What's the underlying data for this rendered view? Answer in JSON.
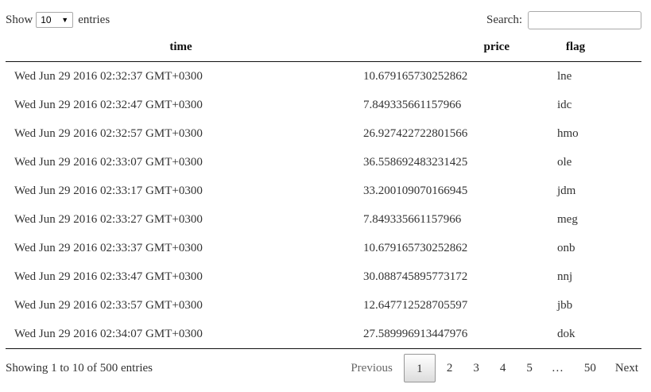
{
  "length_menu": {
    "prefix": "Show",
    "selected": "10",
    "suffix": "entries"
  },
  "search": {
    "label": "Search:",
    "value": ""
  },
  "columns": [
    "time",
    "price",
    "flag"
  ],
  "rows": [
    [
      "Wed Jun 29 2016 02:32:37 GMT+0300",
      "10.679165730252862",
      "lne"
    ],
    [
      "Wed Jun 29 2016 02:32:47 GMT+0300",
      "7.849335661157966",
      "idc"
    ],
    [
      "Wed Jun 29 2016 02:32:57 GMT+0300",
      "26.927422722801566",
      "hmo"
    ],
    [
      "Wed Jun 29 2016 02:33:07 GMT+0300",
      "36.558692483231425",
      "ole"
    ],
    [
      "Wed Jun 29 2016 02:33:17 GMT+0300",
      "33.200109070166945",
      "jdm"
    ],
    [
      "Wed Jun 29 2016 02:33:27 GMT+0300",
      "7.849335661157966",
      "meg"
    ],
    [
      "Wed Jun 29 2016 02:33:37 GMT+0300",
      "10.679165730252862",
      "onb"
    ],
    [
      "Wed Jun 29 2016 02:33:47 GMT+0300",
      "30.088745895773172",
      "nnj"
    ],
    [
      "Wed Jun 29 2016 02:33:57 GMT+0300",
      "12.647712528705597",
      "jbb"
    ],
    [
      "Wed Jun 29 2016 02:34:07 GMT+0300",
      "27.589996913447976",
      "dok"
    ]
  ],
  "info": "Showing 1 to 10 of 500 entries",
  "pagination": {
    "previous": "Previous",
    "pages": [
      "1",
      "2",
      "3",
      "4",
      "5"
    ],
    "current": "1",
    "ellipsis": "…",
    "last": "50",
    "next": "Next"
  }
}
